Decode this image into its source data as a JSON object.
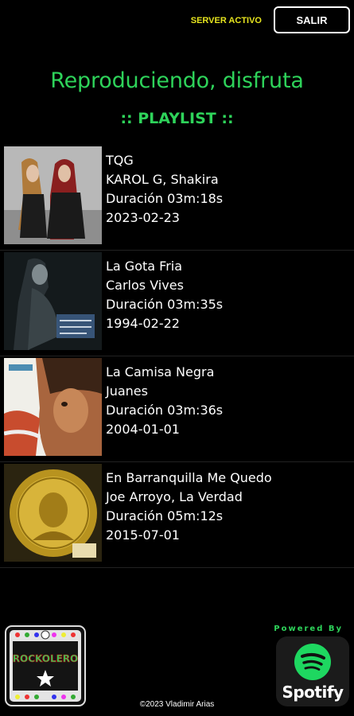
{
  "header": {
    "server_status": "SERVER ACTIVO",
    "logout_label": "SALIR"
  },
  "main": {
    "title": "Reproduciendo, disfruta",
    "subtitle": ":: PLAYLIST ::"
  },
  "playlist": [
    {
      "title": "TQG",
      "artist": "KAROL G, Shakira",
      "duration": "Duración 03m:18s",
      "date": "2023-02-23"
    },
    {
      "title": "La Gota Fria",
      "artist": "Carlos Vives",
      "duration": "Duración 03m:35s",
      "date": "1994-02-22"
    },
    {
      "title": "La Camisa Negra",
      "artist": "Juanes",
      "duration": "Duración 03m:36s",
      "date": "2004-01-01"
    },
    {
      "title": "En Barranquilla Me Quedo",
      "artist": "Joe Arroyo, La Verdad",
      "duration": "Duración 05m:12s",
      "date": "2015-07-01"
    }
  ],
  "footer": {
    "logo_text": "ROCKOLERO",
    "copyright": "©2023 Vladimir Arias",
    "powered_by": "Powered By",
    "spotify_word": "Spotify"
  },
  "colors": {
    "background": "#000000",
    "accent_green": "#2ed35a",
    "server_yellow": "#e6e41e"
  }
}
